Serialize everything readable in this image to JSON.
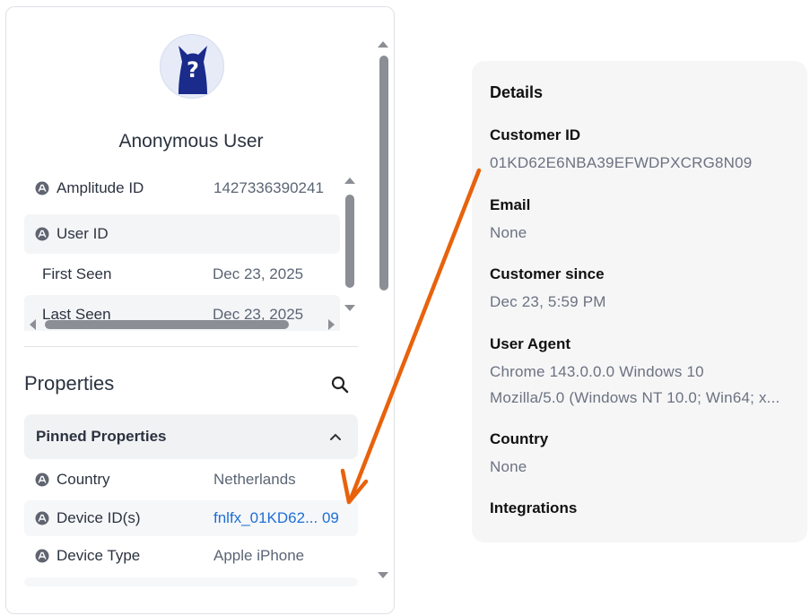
{
  "profile": {
    "name": "Anonymous User",
    "avatar_glyph": "?",
    "avatar_color": "#1a2b8c"
  },
  "identity": {
    "rows": [
      {
        "label": "Amplitude ID",
        "value": "1427336390241",
        "icon": "amplitude-icon"
      },
      {
        "label": "User ID",
        "value": "",
        "icon": "amplitude-icon"
      },
      {
        "label": "First Seen",
        "value": "Dec 23, 2025"
      },
      {
        "label": "Last Seen",
        "value": "Dec 23, 2025"
      }
    ]
  },
  "properties": {
    "title": "Properties",
    "pinned_header": "Pinned Properties",
    "rows": [
      {
        "label": "Country",
        "value": "Netherlands"
      },
      {
        "label": "Device ID(s)",
        "value": "fnlfx_01KD62... 09"
      },
      {
        "label": "Device Type",
        "value": "Apple iPhone"
      }
    ]
  },
  "details": {
    "title": "Details",
    "customer_id_label": "Customer ID",
    "customer_id_value": "01KD62E6NBA39EFWDPXCRG8N09",
    "email_label": "Email",
    "email_value": "None",
    "customer_since_label": "Customer since",
    "customer_since_value": "Dec 23, 5:59 PM",
    "user_agent_label": "User Agent",
    "user_agent_line1": "Chrome 143.0.0.0 Windows 10",
    "user_agent_line2": "Mozilla/5.0 (Windows NT 10.0; Win64; x...",
    "country_label": "Country",
    "country_value": "None",
    "integrations_label": "Integrations"
  },
  "colors": {
    "annotation_arrow": "#e8620c",
    "link": "#1f6fd6"
  }
}
